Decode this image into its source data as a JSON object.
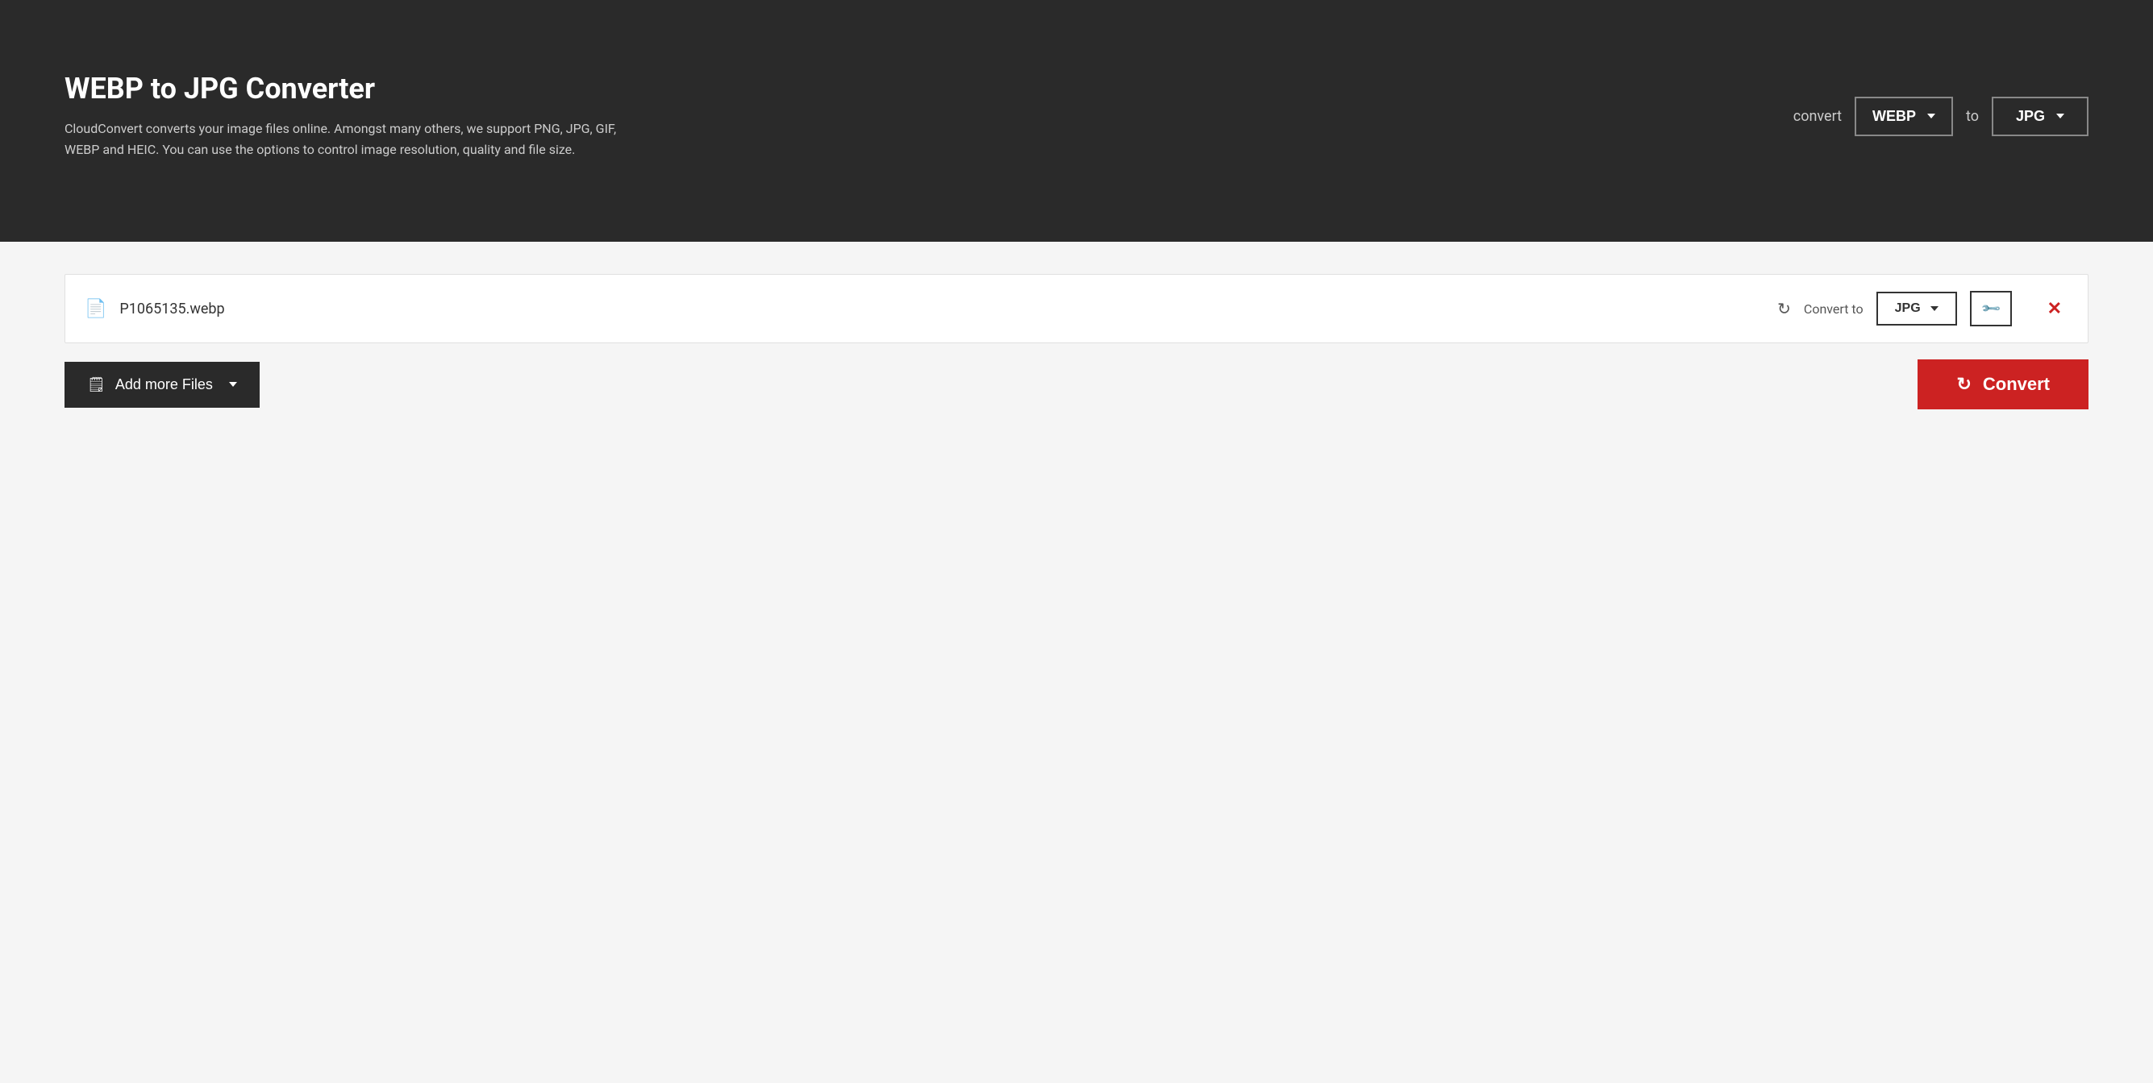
{
  "header": {
    "title": "WEBP to JPG Converter",
    "description": "CloudConvert converts your image files online. Amongst many others, we support PNG, JPG, GIF, WEBP and HEIC. You can use the options to control image resolution, quality and file size.",
    "convert_label": "convert",
    "source_format": "WEBP",
    "to_label": "to",
    "target_format": "JPG"
  },
  "file_row": {
    "file_name": "P1065135.webp",
    "convert_to_label": "Convert to",
    "format": "JPG"
  },
  "toolbar": {
    "add_files_label": "Add more Files",
    "convert_label": "Convert"
  },
  "icons": {
    "file": "🗒",
    "refresh": "🔄",
    "wrench": "🔧",
    "close": "✕",
    "chevron_down": "▾",
    "add_file": "🗒"
  }
}
